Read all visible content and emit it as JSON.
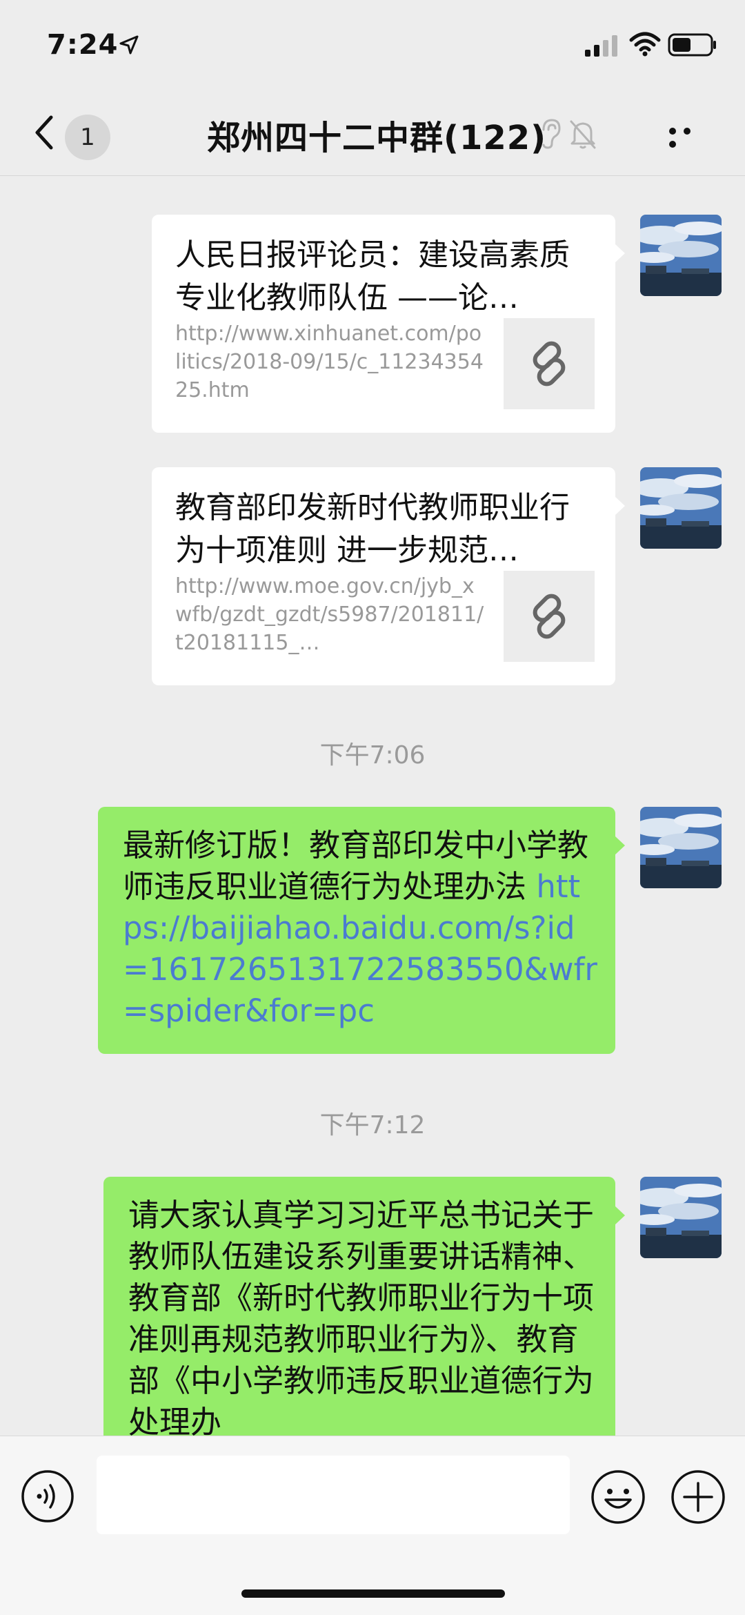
{
  "status_bar": {
    "time": "7:24"
  },
  "nav": {
    "unread_count": "1",
    "title": "郑州四十二中群(122)"
  },
  "messages": [
    {
      "type": "link",
      "title": "人民日报评论员：建设高素质专业化教师队伍 ——论…",
      "url": "http://www.xinhuanet.com/politics/2018-09/15/c_1123435425.htm"
    },
    {
      "type": "link",
      "title": "教育部印发新时代教师职业行为十项准则 进一步规范…",
      "url": "http://www.moe.gov.cn/jyb_xwfb/gzdt_gzdt/s5987/201811/t20181115_…"
    },
    {
      "type": "time",
      "text": "下午7:06"
    },
    {
      "type": "text",
      "text_plain": "最新修订版！教育部印发中小学教师违反职业道德行为处理办法",
      "text_link": "https://baijiahao.baidu.com/s?id=1617265131722583550&wfr=spider&for=pc"
    },
    {
      "type": "time",
      "text": "下午7:12"
    },
    {
      "type": "text",
      "text_plain": "请大家认真学习习近平总书记关于教师队伍建设系列重要讲话精神、教育部《新时代教师职业行为十项准则再规范教师职业行为》、教育部《中小学教师违反职业道德行为处理办"
    }
  ],
  "input_bar": {
    "placeholder": ""
  },
  "colors": {
    "background": "#ededed",
    "bubble_green": "#95ec69",
    "link_blue": "#4b7bd0",
    "timestamp_gray": "#9a9a9a"
  },
  "icons": [
    "location-arrow-icon",
    "signal-icon",
    "wifi-icon",
    "battery-icon",
    "back-chevron-icon",
    "ear-icon",
    "mute-bell-icon",
    "more-dots-icon",
    "link-icon",
    "voice-icon",
    "emoji-icon",
    "plus-icon"
  ]
}
